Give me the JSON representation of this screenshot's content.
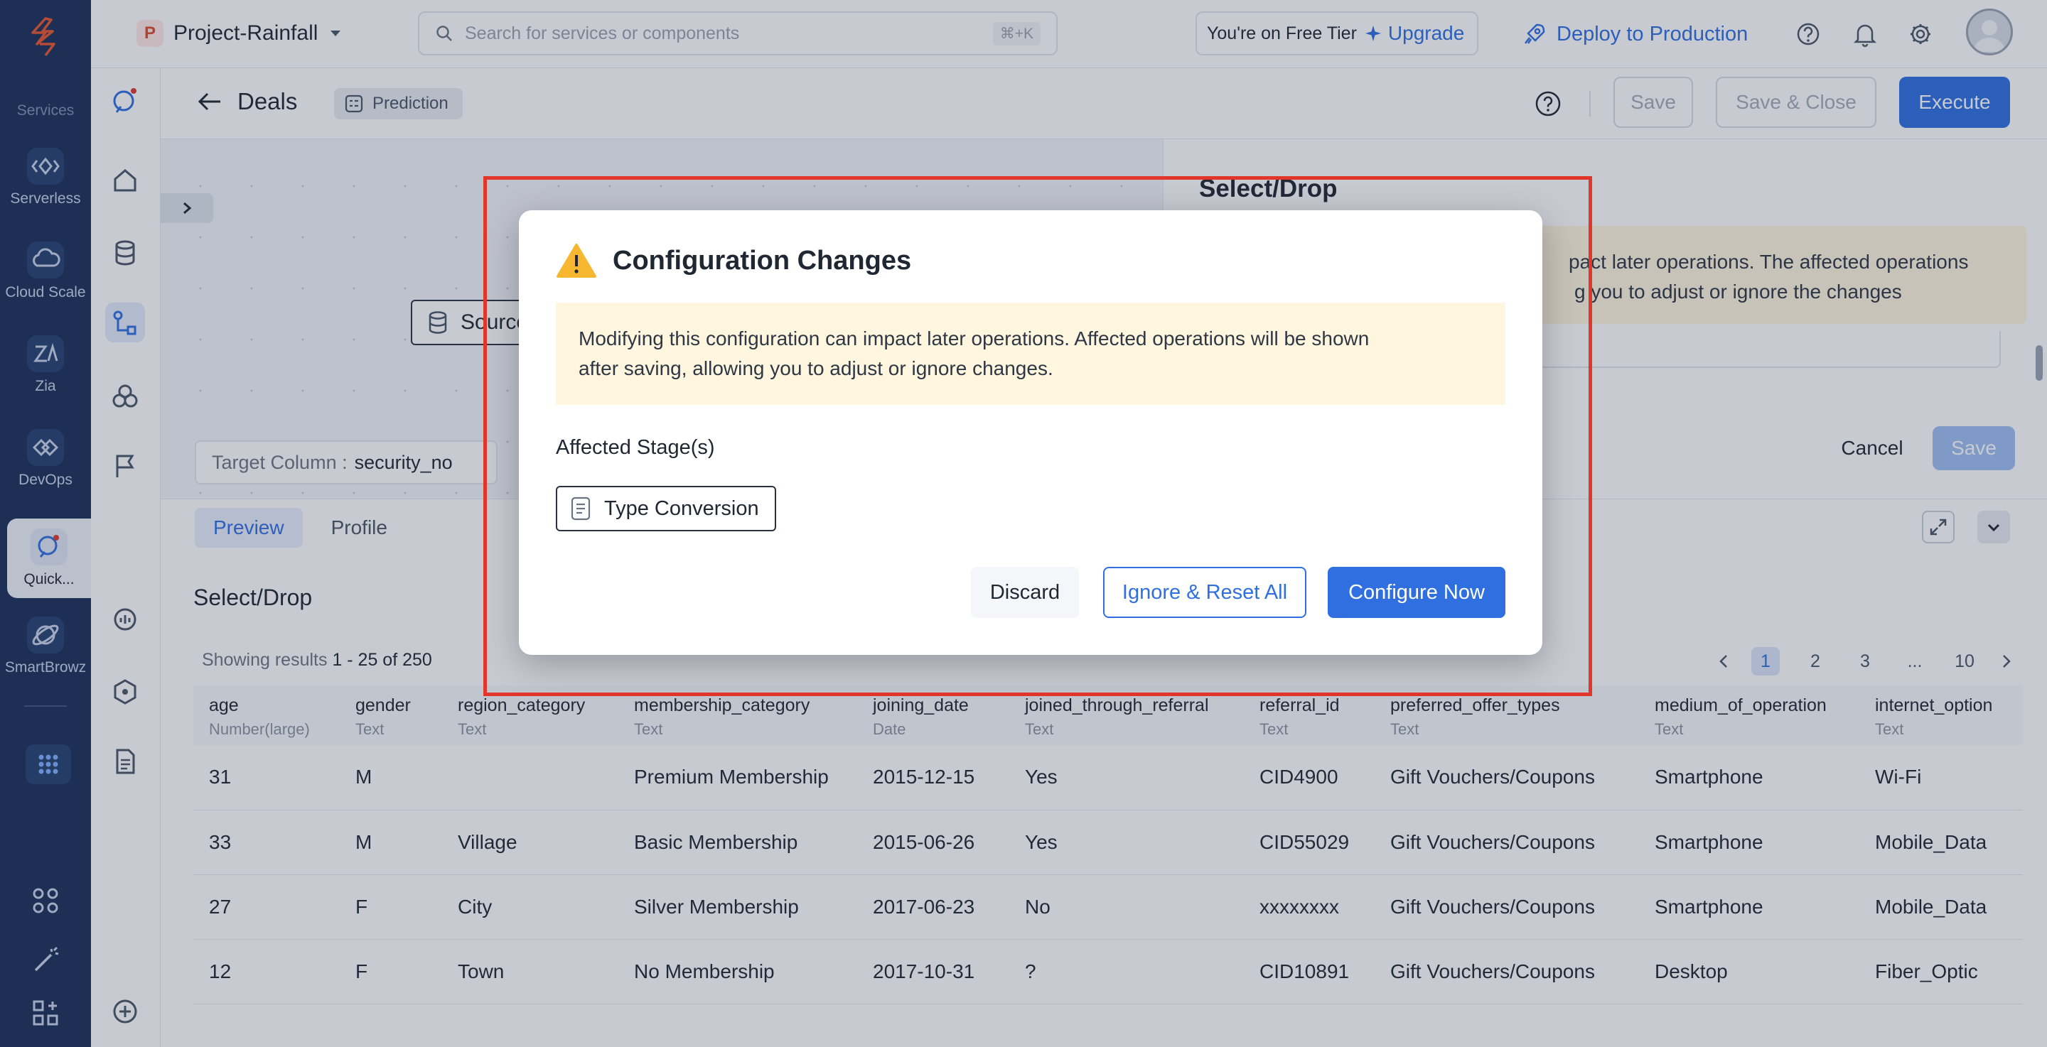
{
  "topbar": {
    "project_name": "Project-Rainfall",
    "project_initial": "P",
    "search_placeholder": "Search for services or components",
    "search_shortcut": "⌘+K",
    "tier_text": "You're on Free Tier",
    "upgrade_label": "Upgrade",
    "deploy_label": "Deploy to Production"
  },
  "rail": {
    "section_label": "Services",
    "items": [
      {
        "label": "Serverless",
        "icon": "serverless-icon"
      },
      {
        "label": "Cloud Scale",
        "icon": "cloud-scale-icon"
      },
      {
        "label": "Zia",
        "icon": "zia-icon"
      },
      {
        "label": "DevOps",
        "icon": "devops-icon"
      },
      {
        "label": "Quick...",
        "icon": "quickml-icon"
      },
      {
        "label": "SmartBrowz",
        "icon": "smartbrowz-icon"
      }
    ]
  },
  "header": {
    "title": "Deals",
    "badge": "Prediction",
    "save_label": "Save",
    "save_close_label": "Save & Close",
    "execute_label": "Execute"
  },
  "canvas": {
    "source_node": "Source",
    "target_label": "Target Column :",
    "target_value": "security_no"
  },
  "right_panel": {
    "title": "Select/Drop",
    "warning_line1": "pact later operations. The affected operations",
    "warning_line2": "g you to adjust or ignore the changes",
    "cancel_label": "Cancel",
    "save_label": "Save"
  },
  "bottom": {
    "tabs": [
      "Preview",
      "Profile"
    ],
    "section_title": "Select/Drop",
    "results_prefix": "Showing results",
    "results_range": "1 - 25 of 250",
    "pages": [
      "1",
      "2",
      "3",
      "...",
      "10"
    ],
    "columns": [
      {
        "name": "age",
        "type": "Number(large)"
      },
      {
        "name": "gender",
        "type": "Text"
      },
      {
        "name": "region_category",
        "type": "Text"
      },
      {
        "name": "membership_category",
        "type": "Text"
      },
      {
        "name": "joining_date",
        "type": "Date"
      },
      {
        "name": "joined_through_referral",
        "type": "Text"
      },
      {
        "name": "referral_id",
        "type": "Text"
      },
      {
        "name": "preferred_offer_types",
        "type": "Text"
      },
      {
        "name": "medium_of_operation",
        "type": "Text"
      },
      {
        "name": "internet_option",
        "type": "Text"
      }
    ],
    "rows": [
      [
        "31",
        "M",
        "",
        "Premium Membership",
        "2015-12-15",
        "Yes",
        "CID4900",
        "Gift Vouchers/Coupons",
        "Smartphone",
        "Wi-Fi"
      ],
      [
        "33",
        "M",
        "Village",
        "Basic Membership",
        "2015-06-26",
        "Yes",
        "CID55029",
        "Gift Vouchers/Coupons",
        "Smartphone",
        "Mobile_Data"
      ],
      [
        "27",
        "F",
        "City",
        "Silver Membership",
        "2017-06-23",
        "No",
        "xxxxxxxx",
        "Gift Vouchers/Coupons",
        "Smartphone",
        "Mobile_Data"
      ],
      [
        "12",
        "F",
        "Town",
        "No Membership",
        "2017-10-31",
        "?",
        "CID10891",
        "Gift Vouchers/Coupons",
        "Desktop",
        "Fiber_Optic"
      ]
    ]
  },
  "modal": {
    "title": "Configuration Changes",
    "warning_line1": "Modifying this configuration can impact later operations. Affected operations will be shown",
    "warning_line2": "after saving, allowing you to adjust or ignore changes.",
    "affected_label": "Affected Stage(s)",
    "stage_name": "Type Conversion",
    "discard_label": "Discard",
    "ignore_label": "Ignore & Reset All",
    "configure_label": "Configure Now"
  },
  "colors": {
    "accent": "#2f6fe0",
    "rail": "#1a2e57",
    "warning_bg": "#fff6df",
    "highlight": "#e2362b"
  }
}
